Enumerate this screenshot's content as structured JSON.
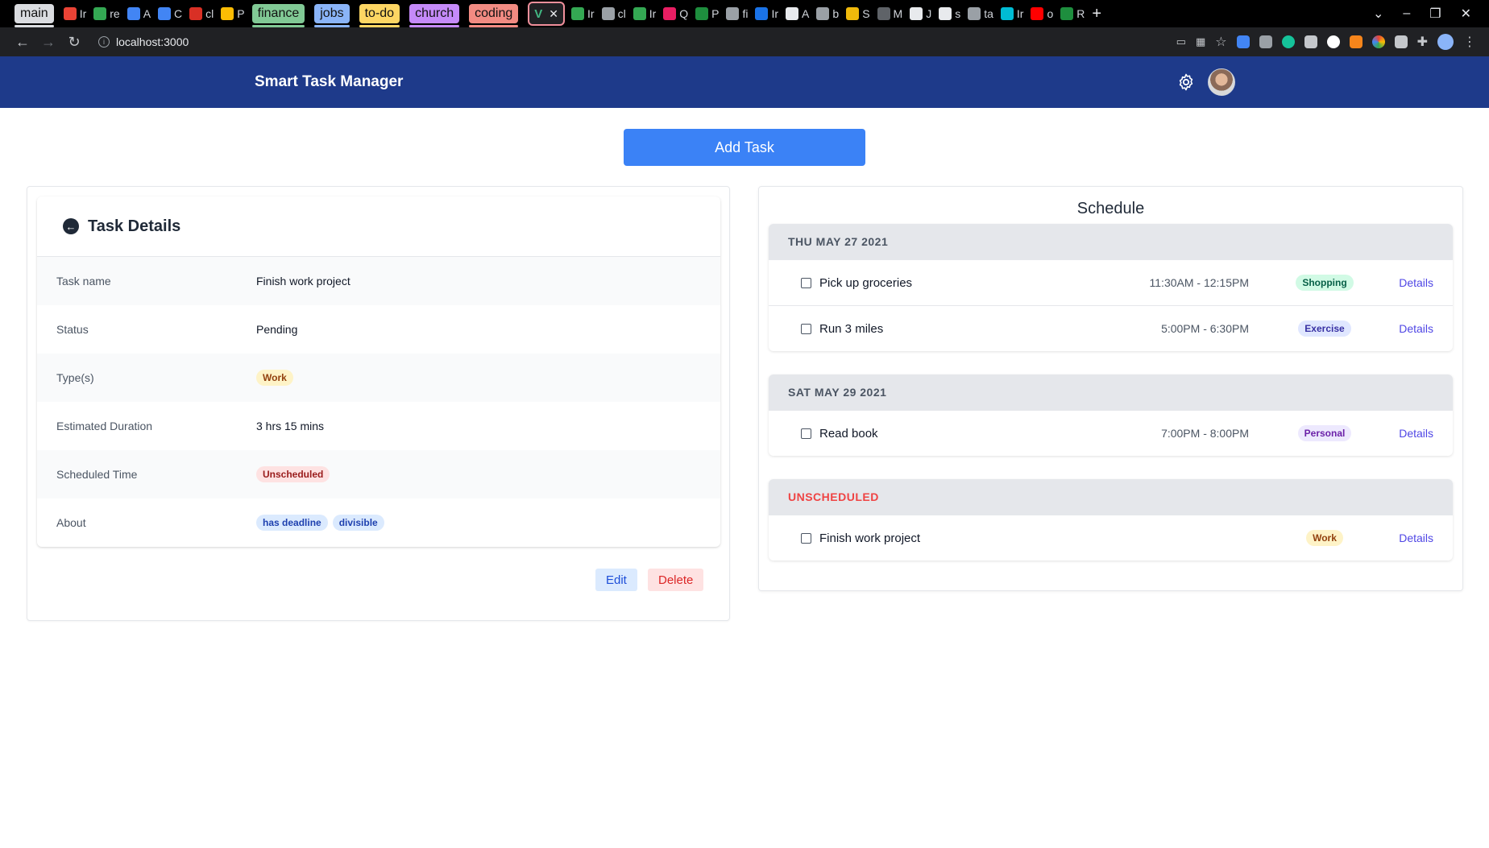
{
  "browser": {
    "tab_groups": [
      {
        "label": "main",
        "color": "#dadce0"
      },
      {
        "label": "finance",
        "color": "#81c995"
      },
      {
        "label": "jobs",
        "color": "#8ab4f8"
      },
      {
        "label": "to-do",
        "color": "#fdd663"
      },
      {
        "label": "church",
        "color": "#c58af9"
      },
      {
        "label": "coding",
        "color": "#f28b82"
      }
    ],
    "tab_snippets": [
      "Ir",
      "re",
      "A",
      "C",
      "cl",
      "P"
    ],
    "more_tab_snippets": [
      "Ir",
      "cl",
      "Ir",
      "Q",
      "P",
      "fi",
      "Ir",
      "A",
      "b",
      "S",
      "M",
      "J",
      "s",
      "ta",
      "Ir",
      "o",
      "R"
    ],
    "url": "localhost:3000"
  },
  "app": {
    "title": "Smart Task Manager",
    "add_task_label": "Add Task"
  },
  "task_details": {
    "heading": "Task Details",
    "rows": [
      {
        "label": "Task name",
        "value": "Finish work project"
      },
      {
        "label": "Status",
        "value": "Pending"
      },
      {
        "label": "Type(s)",
        "tags": [
          "Work"
        ]
      },
      {
        "label": "Estimated Duration",
        "value": "3 hrs 15 mins"
      },
      {
        "label": "Scheduled Time",
        "tags": [
          "Unscheduled"
        ]
      },
      {
        "label": "About",
        "tags": [
          "has deadline",
          "divisible"
        ]
      }
    ],
    "edit_label": "Edit",
    "delete_label": "Delete"
  },
  "schedule": {
    "heading": "Schedule",
    "groups": [
      {
        "date": "THU MAY 27 2021",
        "items": [
          {
            "name": "Pick up groceries",
            "time": "11:30AM - 12:15PM",
            "tag": "Shopping",
            "link": "Details"
          },
          {
            "name": "Run 3 miles",
            "time": "5:00PM - 6:30PM",
            "tag": "Exercise",
            "link": "Details"
          }
        ]
      },
      {
        "date": "SAT MAY 29 2021",
        "items": [
          {
            "name": "Read book",
            "time": "7:00PM - 8:00PM",
            "tag": "Personal",
            "link": "Details"
          }
        ]
      },
      {
        "date": "UNSCHEDULED",
        "items": [
          {
            "name": "Finish work project",
            "time": "",
            "tag": "Work",
            "link": "Details"
          }
        ]
      }
    ]
  },
  "colors": {
    "header_bg": "#1e3a8a",
    "primary": "#3b82f6",
    "link": "#4f46e5",
    "unscheduled": "#ef4444"
  }
}
